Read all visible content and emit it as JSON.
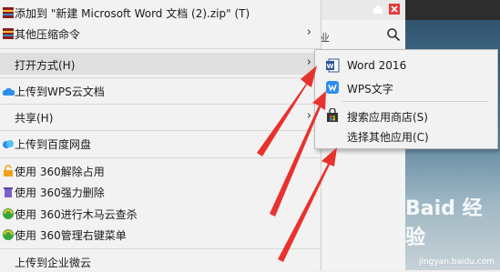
{
  "menu": {
    "items": [
      {
        "label": "添加到 \"新建 Microsoft Word 文档 (2).zip\" (T)",
        "icon": "zip-archive-icon"
      },
      {
        "label": "其他压缩命令",
        "icon": "zip-archive-icon",
        "has_submenu": true
      },
      {
        "label": "打开方式(H)",
        "has_submenu": true,
        "highlighted": true
      },
      {
        "label": "上传到WPS云文档",
        "icon": "wps-cloud-icon"
      },
      {
        "label": "共享(H)",
        "has_submenu": true
      },
      {
        "label": "上传到百度网盘",
        "icon": "baidu-netdisk-icon"
      },
      {
        "label": "使用 360解除占用",
        "icon": "360-unlock-icon"
      },
      {
        "label": "使用 360强力删除",
        "icon": "360-delete-icon"
      },
      {
        "label": "使用 360进行木马云查杀",
        "icon": "360-scan-icon"
      },
      {
        "label": "使用 360管理右键菜单",
        "icon": "360-menu-icon"
      },
      {
        "label": "上传到企业微云",
        "icon": "weiyun-icon"
      }
    ]
  },
  "submenu": {
    "items": [
      {
        "label": "Word 2016",
        "icon": "word-icon"
      },
      {
        "label": "WPS文字",
        "icon": "wps-writer-icon"
      },
      {
        "label": "搜索应用商店(S)",
        "icon": "store-icon"
      },
      {
        "label": "选择其他应用(C)"
      }
    ]
  },
  "background": {
    "search_hint": "业"
  },
  "watermark": {
    "text": "Baid 经验",
    "sub": "jingyan.baidu.com"
  },
  "colors": {
    "arrow": "#e8322d",
    "word_blue": "#2b579a",
    "wps_blue": "#2d8cf0",
    "highlight": "#dfdfdf"
  }
}
